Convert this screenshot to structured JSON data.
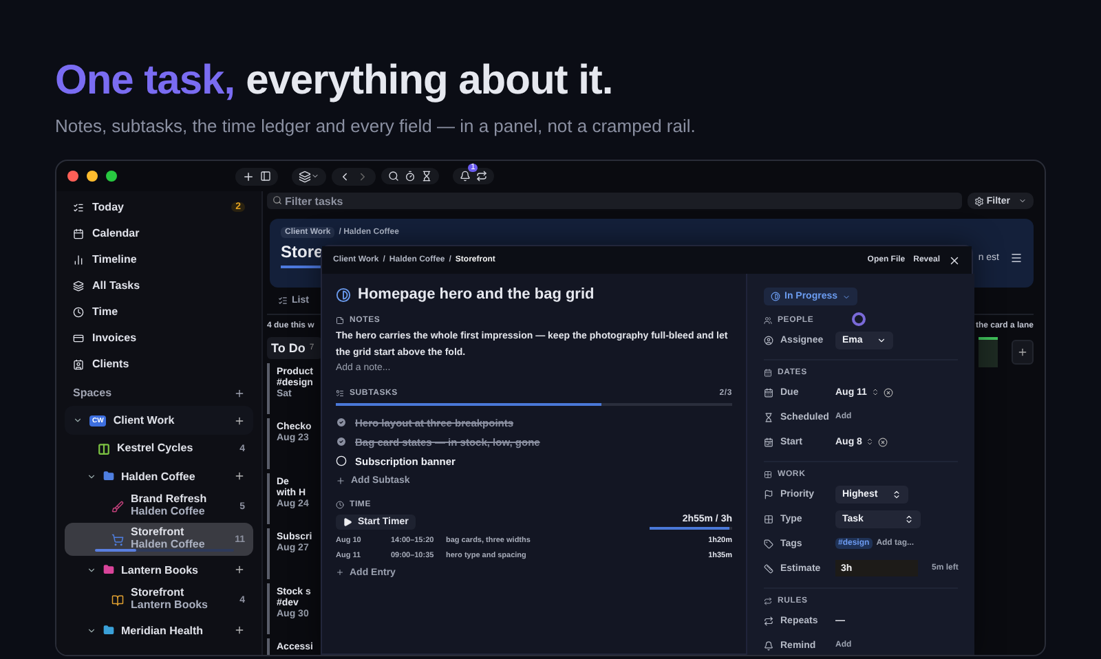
{
  "hero": {
    "title_accent": "One task,",
    "title_rest": "everything about it.",
    "subtitle": "Notes, subtasks, the time ledger and every field — in a panel, not a cramped rail."
  },
  "toolbar": {
    "notification_count": "1"
  },
  "filter": {
    "placeholder": "Filter tasks",
    "button": "Filter"
  },
  "sidebar": {
    "nav": [
      {
        "label": "Today",
        "badge": "2"
      },
      {
        "label": "Calendar"
      },
      {
        "label": "Timeline"
      },
      {
        "label": "All Tasks"
      },
      {
        "label": "Time"
      },
      {
        "label": "Invoices"
      },
      {
        "label": "Clients"
      }
    ],
    "spaces_label": "Spaces",
    "tree": [
      {
        "kind": "space",
        "label": "Client Work",
        "badge": "CW",
        "expanded": true,
        "children": [
          {
            "kind": "project",
            "label": "Kestrel Cycles",
            "count": "4",
            "color": "#7cc242",
            "selected": false
          },
          {
            "kind": "folder",
            "label": "Halden Coffee",
            "color": "#4f7fe0",
            "expanded": true,
            "children": [
              {
                "kind": "project",
                "label": "Brand Refresh",
                "subtitle": "Halden Coffee",
                "count": "5",
                "color": "#c0407a",
                "selected": false
              },
              {
                "kind": "project",
                "label": "Storefront",
                "subtitle": "Halden Coffee",
                "count": "11",
                "color": "#4f7fe0",
                "selected": true,
                "level": 0.3
              }
            ]
          },
          {
            "kind": "folder",
            "label": "Lantern Books",
            "color": "#d9449a",
            "expanded": true,
            "children": [
              {
                "kind": "project",
                "label": "Storefront",
                "subtitle": "Lantern Books",
                "count": "4",
                "color": "#e0a030",
                "selected": false
              }
            ]
          },
          {
            "kind": "folder",
            "label": "Meridian Health",
            "color": "#3aa0d8",
            "expanded": true
          }
        ]
      }
    ]
  },
  "board": {
    "breadcrumb": [
      "Client Work",
      "/ Halden Coffee"
    ],
    "title": "Store",
    "right_text": "n est",
    "tab": "List",
    "due_text": "4 due this w",
    "hint": "the card a lane",
    "column": {
      "title": "To Do",
      "count": "7"
    },
    "cards": [
      {
        "lines": [
          "Product",
          "#design"
        ],
        "date": "Sat"
      },
      {
        "lines": [
          "Checko"
        ],
        "date": "Aug 23"
      },
      {
        "lines": [
          "De",
          "with H"
        ],
        "date": "Aug 24"
      },
      {
        "lines": [
          "Subscri"
        ],
        "date": "Aug 27"
      },
      {
        "lines": [
          "Stock s",
          "#dev"
        ],
        "date": "Aug 30"
      },
      {
        "lines": [
          "Accessi"
        ]
      }
    ]
  },
  "panel": {
    "breadcrumb": [
      "Client Work",
      "/",
      "Halden Coffee",
      "/",
      "Storefront"
    ],
    "actions": [
      "Open File",
      "Reveal"
    ],
    "title": "Homepage hero and the bag grid",
    "notes": {
      "label": "NOTES",
      "text": "The hero carries the whole first impression — keep the photography full-bleed and let the grid start above the fold.",
      "placeholder": "Add a note..."
    },
    "subtasks": {
      "label": "SUBTASKS",
      "progress_text": "2/3",
      "level": 0.67,
      "add_label": "Add Subtask",
      "items": [
        {
          "label": "Hero layout at three breakpoints",
          "done": true
        },
        {
          "label": "Bag card states — in stock, low, gone",
          "done": true
        },
        {
          "label": "Subscription banner",
          "done": false
        }
      ]
    },
    "time": {
      "label": "TIME",
      "start_label": "Start Timer",
      "total": "2h55m / 3h",
      "level": 0.97,
      "add_label": "Add Entry",
      "entries": [
        {
          "date": "Aug 10",
          "range": "14:00–15:20",
          "note": "bag cards, three widths",
          "duration": "1h20m"
        },
        {
          "date": "Aug 11",
          "range": "09:00–10:35",
          "note": "hero type and spacing",
          "duration": "1h35m"
        }
      ]
    },
    "status": "In Progress",
    "sections": [
      {
        "title": "PEOPLE",
        "fields": [
          {
            "kind": "select",
            "label": "Assignee",
            "value": "Ema"
          }
        ]
      },
      {
        "title": "DATES",
        "fields": [
          {
            "kind": "date",
            "label": "Due",
            "value": "Aug 11"
          },
          {
            "kind": "link",
            "label": "Scheduled",
            "value": "Add"
          },
          {
            "kind": "date",
            "label": "Start",
            "value": "Aug 8"
          }
        ]
      },
      {
        "title": "WORK",
        "fields": [
          {
            "kind": "stepper",
            "label": "Priority",
            "value": "Highest"
          },
          {
            "kind": "stepper",
            "label": "Type",
            "value": "Task"
          },
          {
            "kind": "tags",
            "label": "Tags",
            "tags": [
              "#design"
            ],
            "placeholder": "Add tag..."
          },
          {
            "kind": "input",
            "label": "Estimate",
            "value": "3h",
            "note": "5m left"
          }
        ]
      },
      {
        "title": "RULES",
        "fields": [
          {
            "kind": "text",
            "label": "Repeats",
            "value": "—"
          },
          {
            "kind": "link",
            "label": "Remind",
            "value": "Add"
          }
        ]
      }
    ]
  }
}
